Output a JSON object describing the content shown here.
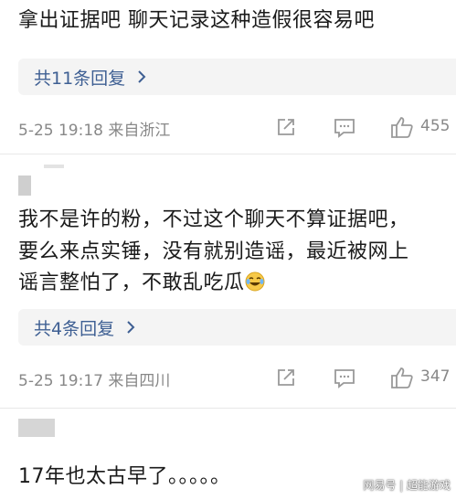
{
  "comments": [
    {
      "lines": [
        "拿出证据吧 聊天记录这种造假很容易吧"
      ],
      "replies_label": "共11条回复",
      "meta": "5-25 19:18 来自浙江",
      "likes": "455"
    },
    {
      "lines": [
        "我不是许的粉，不过这个聊天不算证据吧，",
        "要么来点实锤，没有就别造谣，最近被网上",
        "谣言整怕了，不敢乱吃瓜"
      ],
      "emoji": "crying-laughing-emoji",
      "replies_label": "共4条回复",
      "meta": "5-25 19:17 来自四川",
      "likes": "347"
    },
    {
      "lines": [
        "17年也太古早了。。。。。"
      ]
    }
  ],
  "watermark": "网易号 | 超能游戏",
  "colors": {
    "link": "#3e5f93",
    "meta": "#888888",
    "reply_bg": "#f4f4f4"
  }
}
